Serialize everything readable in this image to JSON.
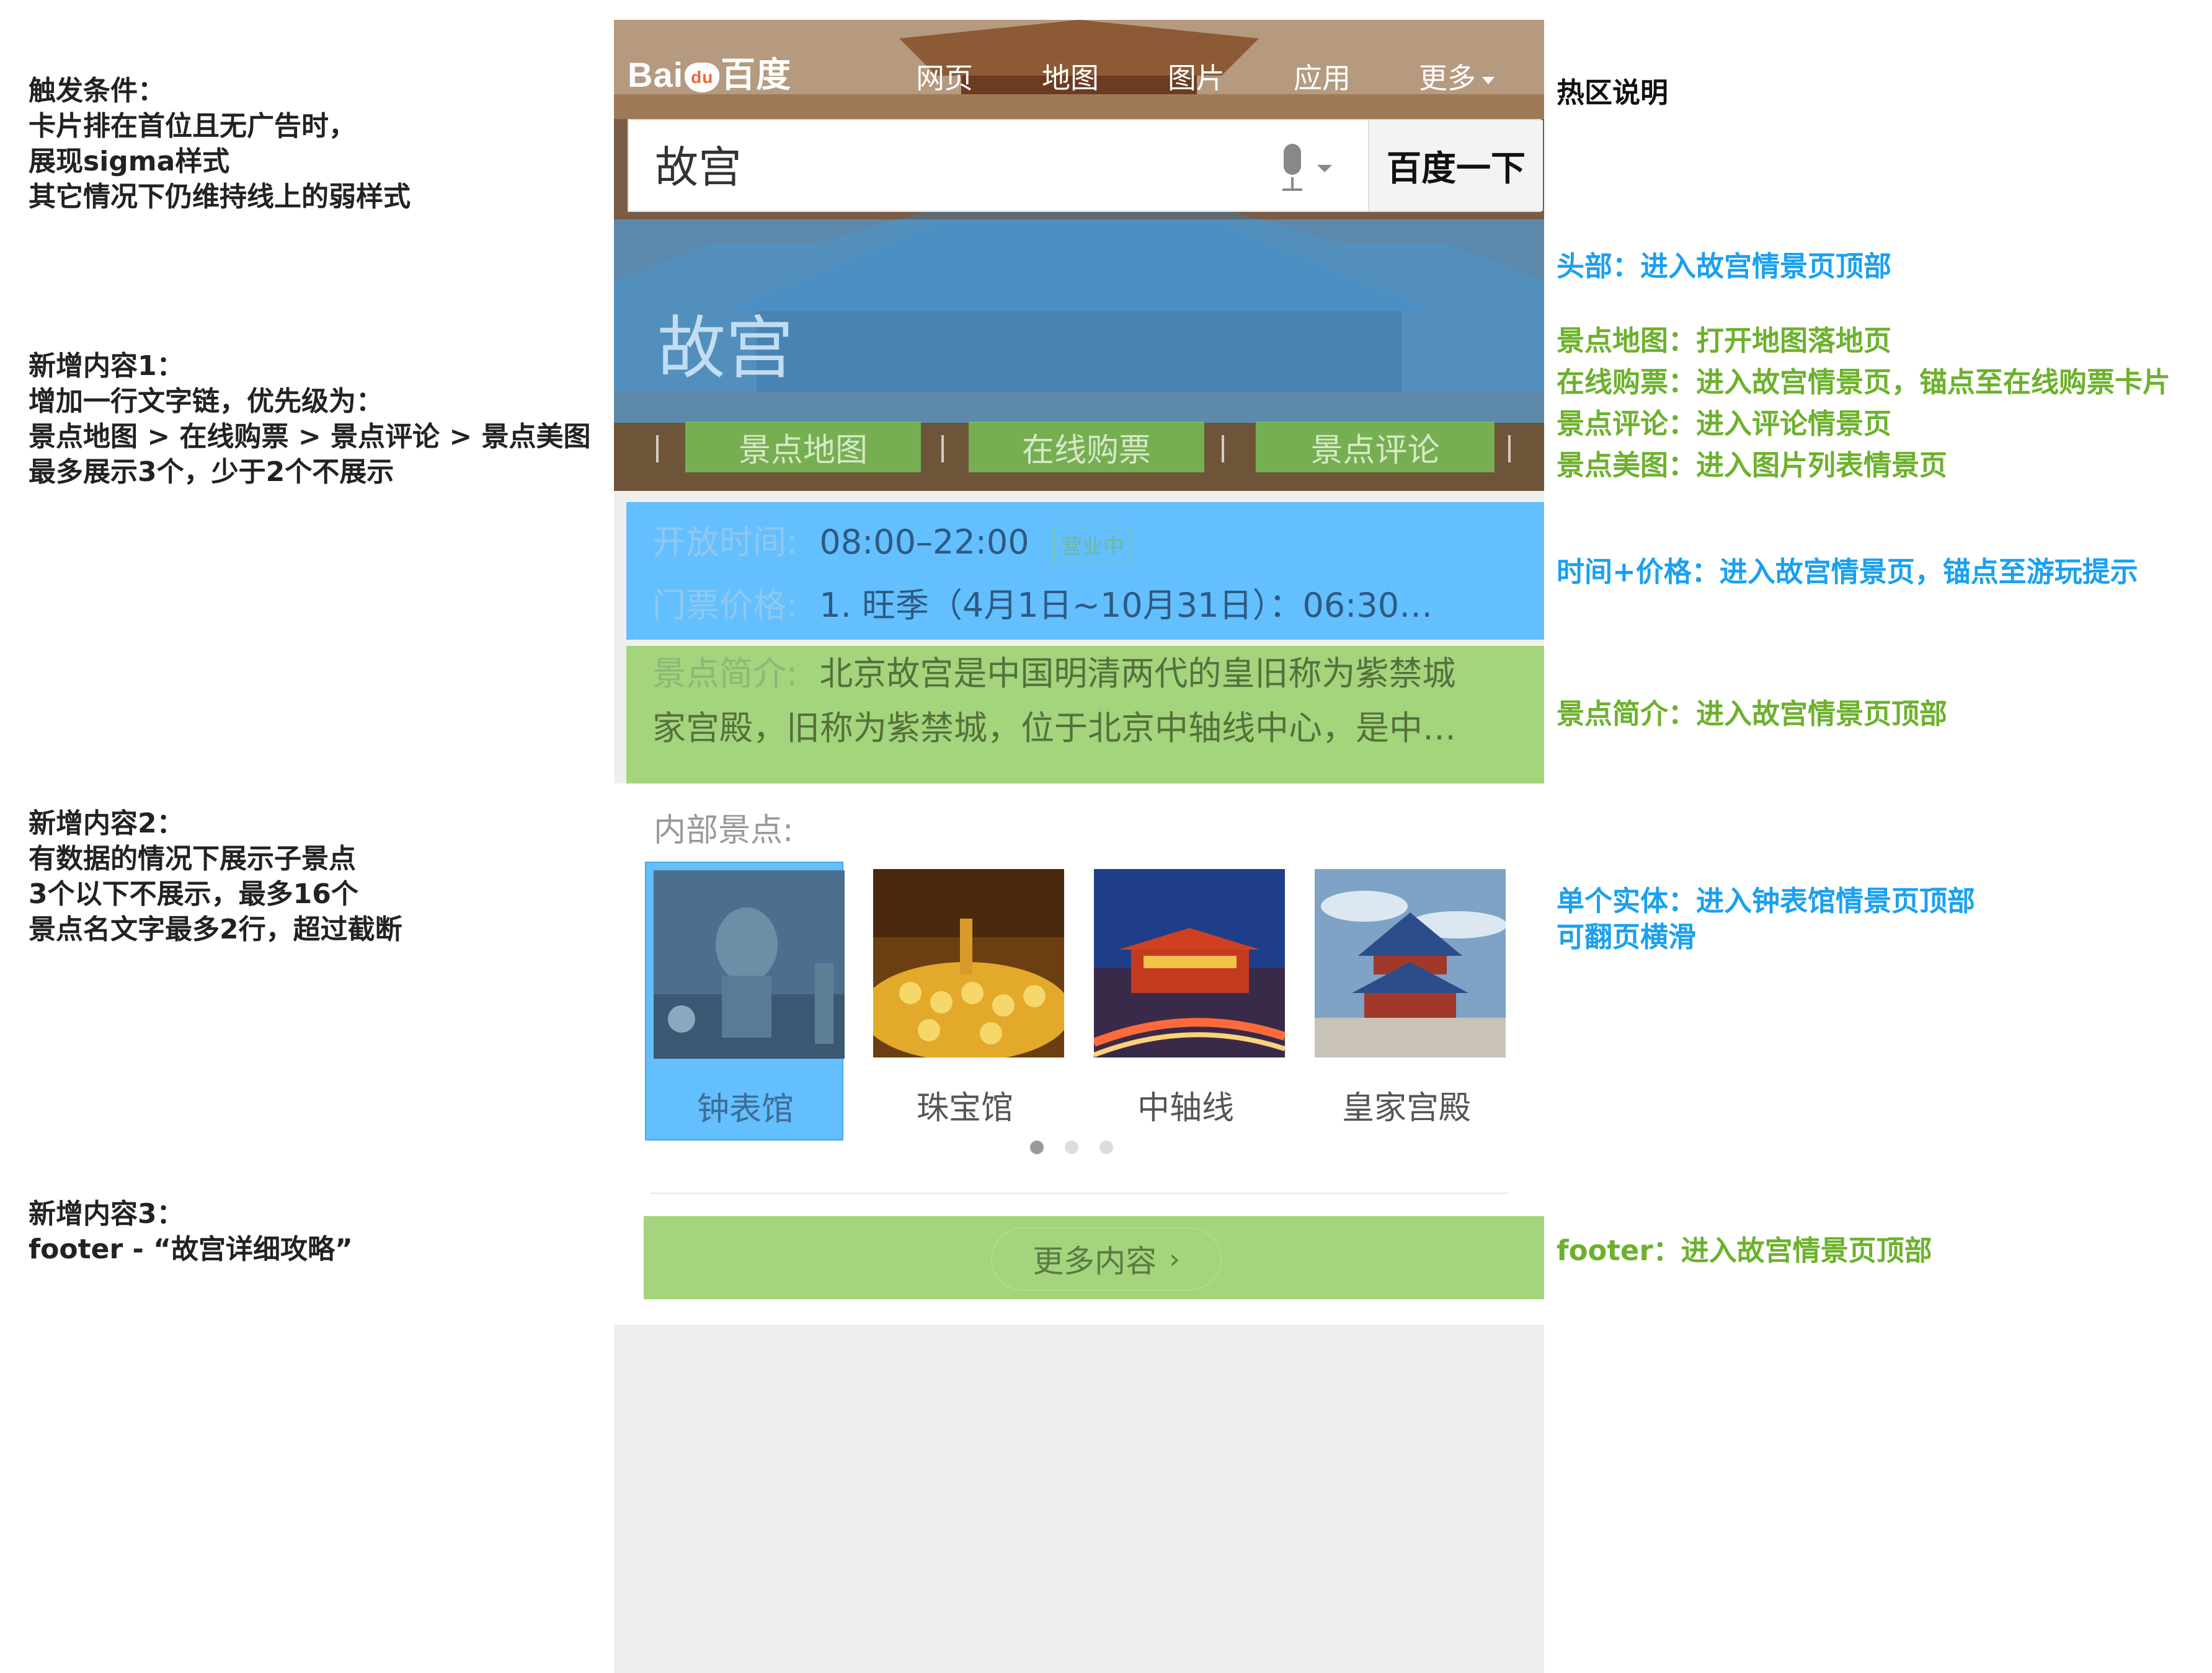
{
  "notes": {
    "trigger": [
      "触发条件：",
      "卡片排在首位且无广告时，",
      "展现sigma样式",
      "其它情况下仍维持线上的弱样式"
    ],
    "new1": [
      "新增内容1：",
      "增加一行文字链，优先级为：",
      "景点地图 > 在线购票 > 景点评论 > 景点美图",
      "最多展示3个，少于2个不展示"
    ],
    "new2": [
      "新增内容2：",
      "有数据的情况下展示子景点",
      "3个以下不展示，最多16个",
      "景点名文字最多2行，超过截断"
    ],
    "new3": [
      "新增内容3：",
      "footer - “故宫详细攻略”"
    ]
  },
  "hotspot": {
    "title": "热区说明",
    "header": "头部：进入故宫情景页顶部",
    "links": [
      "景点地图：打开地图落地页",
      "在线购票：进入故宫情景页，锚点至在线购票卡片",
      "景点评论：进入评论情景页",
      "景点美图：进入图片列表情景页"
    ],
    "time_price": "时间+价格：进入故宫情景页，锚点至游玩提示",
    "intro": "景点简介：进入故宫情景页顶部",
    "entity": [
      "单个实体：进入钟表馆情景页顶部",
      "可翻页横滑"
    ],
    "footer": "footer：进入故宫情景页顶部"
  },
  "colors": {
    "blue": "#1aa0f0",
    "green": "#6cb12c",
    "overlay_blue": "#64bfff",
    "overlay_green": "#a4d47c"
  },
  "nav": {
    "logo_left": "Bai",
    "logo_paw": "du",
    "logo_right": "百度",
    "items": [
      "网页",
      "地图",
      "图片",
      "应用",
      "更多"
    ]
  },
  "search": {
    "value": "故宫",
    "button": "百度一下"
  },
  "card": {
    "title": "故宫",
    "links": [
      "景点地图",
      "在线购票",
      "景点评论"
    ],
    "time_label": "开放时间:",
    "time_value": "08:00–22:00",
    "status": "营业中",
    "price_label": "门票价格:",
    "price_value": "1. 旺季（4月1日~10月31日）：06:30…",
    "intro_label": "景点简介:",
    "intro_line1": "北京故宫是中国明清两代的皇旧称为紫禁城",
    "intro_line2": "家宫殿，旧称为紫禁城，位于北京中轴线中心，是中…",
    "inner_label": "内部景点:",
    "spots": [
      "钟表馆",
      "珠宝馆",
      "中轴线",
      "皇家宫殿"
    ],
    "more": "更多内容",
    "page_count": 3,
    "active_page": 1
  }
}
